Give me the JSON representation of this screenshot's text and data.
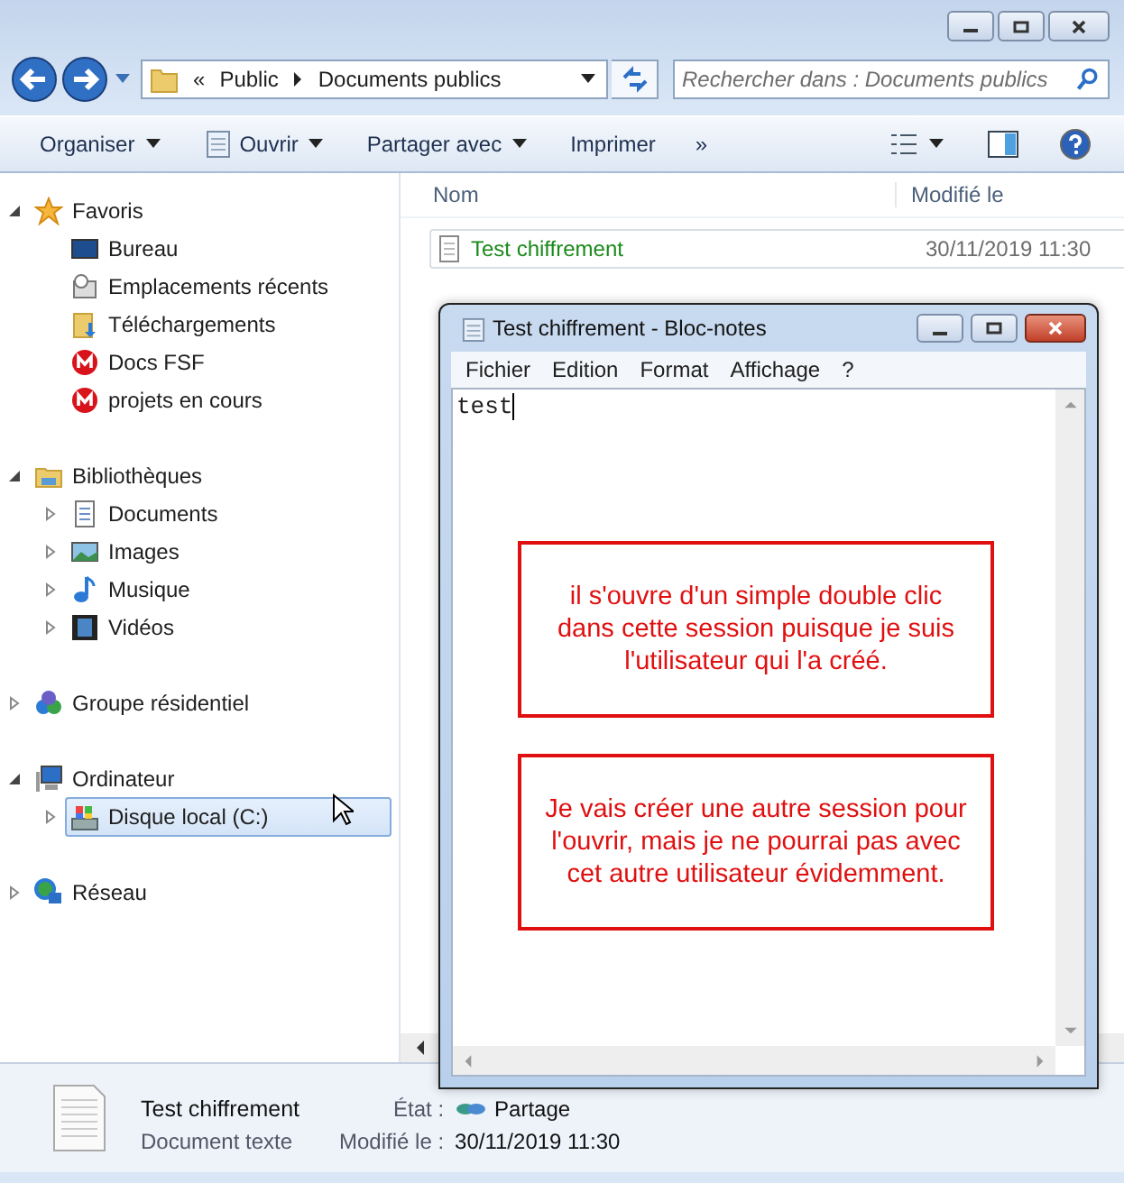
{
  "address": {
    "overflow": "«",
    "segments": [
      "Public",
      "Documents publics"
    ]
  },
  "search": {
    "placeholder": "Rechercher dans : Documents publics"
  },
  "toolbar": {
    "items": [
      {
        "label": "Ouvrir",
        "kind": "icon-dropdown"
      },
      {
        "label": "Partager avec",
        "kind": "dropdown"
      },
      {
        "label": "Imprimer",
        "kind": "plain"
      }
    ],
    "organise": "Organiser",
    "more": "»"
  },
  "nav": [
    {
      "label": "Favoris",
      "expanded": true,
      "selected": false,
      "children": [
        {
          "label": "Bureau",
          "selected": false
        },
        {
          "label": "Emplacements récents",
          "selected": false
        },
        {
          "label": "Téléchargements",
          "selected": false
        },
        {
          "label": "Docs FSF",
          "selected": false
        },
        {
          "label": "projets en cours",
          "selected": false
        }
      ]
    },
    {
      "label": "Bibliothèques",
      "expanded": true,
      "selected": false,
      "children": [
        {
          "label": "Documents",
          "expanded": false,
          "selected": false
        },
        {
          "label": "Images",
          "expanded": false,
          "selected": false
        },
        {
          "label": "Musique",
          "expanded": false,
          "selected": false
        },
        {
          "label": "Vidéos",
          "expanded": false,
          "selected": false
        }
      ]
    },
    {
      "label": "Groupe résidentiel",
      "expanded": false,
      "selected": false
    },
    {
      "label": "Ordinateur",
      "expanded": true,
      "selected": false,
      "children": [
        {
          "label": "Disque local (C:)",
          "expanded": false,
          "selected": true
        }
      ]
    },
    {
      "label": "Réseau",
      "expanded": false,
      "selected": false
    }
  ],
  "file_list": {
    "columns": [
      "Nom",
      "Modifié le"
    ],
    "rows": [
      {
        "name": "Test chiffrement",
        "modified": "30/11/2019 11:30"
      }
    ]
  },
  "notepad": {
    "title": "Test chiffrement - Bloc-notes",
    "menu": [
      "Fichier",
      "Edition",
      "Format",
      "Affichage",
      "?"
    ],
    "content": "test",
    "notes": [
      "il s'ouvre d'un simple double clic dans cette session puisque je suis l'utilisateur qui l'a créé.",
      "Je vais créer une autre session pour l'ouvrir, mais je ne pourrai pas avec cet autre utilisateur évidemment."
    ]
  },
  "details": {
    "name": "Test chiffrement",
    "type": "Document texte",
    "fields": [
      {
        "label": "État :",
        "value": "Partage"
      },
      {
        "label": "Modifié le :",
        "value": "30/11/2019 11:30"
      }
    ]
  }
}
